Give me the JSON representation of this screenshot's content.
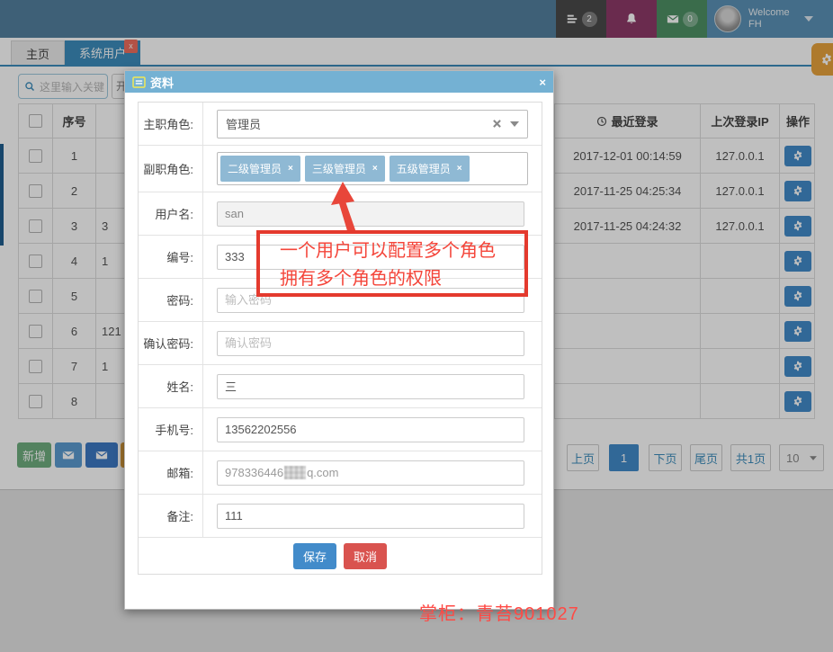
{
  "topbar": {
    "welcome_line1": "Welcome",
    "welcome_line2": "FH",
    "tasks_badge": "2",
    "mail_badge": "0"
  },
  "tabs": {
    "home": "主页",
    "users": "系统用户",
    "close": "x"
  },
  "toolbar": {
    "search_placeholder": "这里输入关键",
    "partial_input": "开"
  },
  "table": {
    "headers": {
      "index": "序号",
      "last_login": "最近登录",
      "last_login_ip": "上次登录IP",
      "actions": "操作"
    },
    "rows": [
      {
        "index": "1",
        "partial": "",
        "last_login": "2017-12-01 00:14:59",
        "ip": "127.0.0.1"
      },
      {
        "index": "2",
        "partial": "",
        "last_login": "2017-11-25 04:25:34",
        "ip": "127.0.0.1"
      },
      {
        "index": "3",
        "partial": "3",
        "last_login": "2017-11-25 04:24:32",
        "ip": "127.0.0.1"
      },
      {
        "index": "4",
        "partial": "1",
        "last_login": "",
        "ip": ""
      },
      {
        "index": "5",
        "partial": "",
        "last_login": "",
        "ip": ""
      },
      {
        "index": "6",
        "partial": "121",
        "last_login": "",
        "ip": ""
      },
      {
        "index": "7",
        "partial": "1",
        "last_login": "",
        "ip": ""
      },
      {
        "index": "8",
        "partial": "",
        "last_login": "",
        "ip": ""
      }
    ]
  },
  "actions_bar": {
    "add_label": "新增"
  },
  "pagination": {
    "prev": "上页",
    "current": "1",
    "next": "下页",
    "last": "尾页",
    "total": "共1页",
    "page_size": "10"
  },
  "modal": {
    "title": "资料",
    "close": "×",
    "fields": {
      "main_role": {
        "label": "主职角色:",
        "value": "管理员"
      },
      "sub_roles": {
        "label": "副职角色:",
        "tags": [
          "二级管理员",
          "三级管理员",
          "五级管理员"
        ],
        "tag_close": "×"
      },
      "username": {
        "label": "用户名:",
        "value": "san"
      },
      "number": {
        "label": "编号:",
        "value": "333"
      },
      "password": {
        "label": "密码:",
        "placeholder": "输入密码"
      },
      "password2": {
        "label": "确认密码:",
        "placeholder": "确认密码"
      },
      "name": {
        "label": "姓名:",
        "value": "三"
      },
      "phone": {
        "label": "手机号:",
        "value": "13562202556"
      },
      "email": {
        "label": "邮箱:",
        "value_prefix": "978336446",
        "value_suffix": "q.com"
      },
      "remark": {
        "label": "备注:",
        "value": "111"
      }
    },
    "save_label": "保存",
    "cancel_label": "取消"
  },
  "annotation": {
    "line1": "一个用户可以配置多个角色",
    "line2": "拥有多个角色的权限"
  },
  "watermark": "掌柜：青苔901027",
  "colors": {
    "accent": "#3c8dbc",
    "danger": "#d9534f",
    "tag_blue": "#8fb9d4",
    "orange": "#e8a33d",
    "annotation_red": "#e43a2e"
  }
}
